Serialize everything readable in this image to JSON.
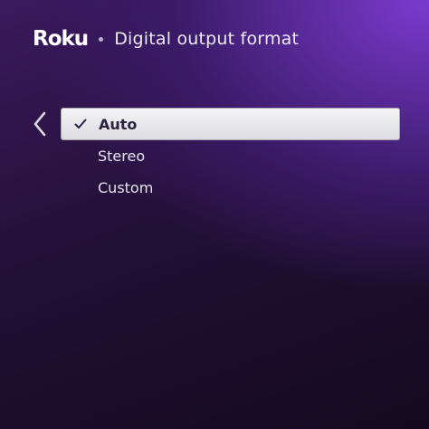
{
  "header": {
    "logo": "Roku",
    "title": "Digital output format"
  },
  "icons": {
    "back": "chevron-left-icon",
    "check": "checkmark-icon"
  },
  "menu": {
    "items": [
      {
        "label": "Auto",
        "selected": true
      },
      {
        "label": "Stereo",
        "selected": false
      },
      {
        "label": "Custom",
        "selected": false
      }
    ]
  },
  "colors": {
    "accent": "#6f2dbd",
    "selected_bg": "#ebebef",
    "selected_text": "#2b2140"
  }
}
